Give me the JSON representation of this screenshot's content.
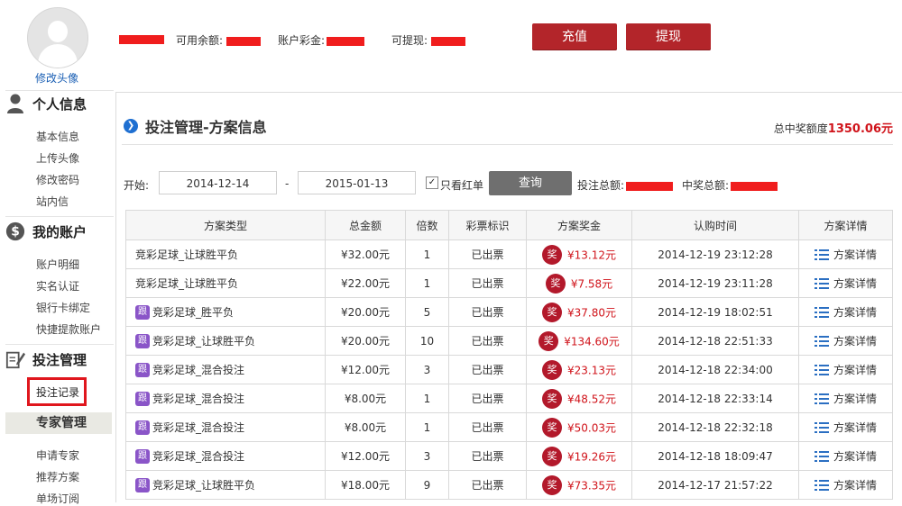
{
  "profile": {
    "change_avatar": "修改头像",
    "available_label": "可用余额:",
    "prize_label": "账户彩金:",
    "withdrawable_label": "可提现:"
  },
  "actions": {
    "recharge": "充值",
    "withdraw": "提现"
  },
  "sidebar": {
    "sections": [
      {
        "title": "个人信息",
        "icon": "user-icon",
        "items": [
          "基本信息",
          "上传头像",
          "修改密码",
          "站内信"
        ]
      },
      {
        "title": "我的账户",
        "icon": "dollar-icon",
        "items": [
          "账户明细",
          "实名认证",
          "银行卡绑定",
          "快捷提款账户"
        ]
      },
      {
        "title": "投注管理",
        "icon": "edit-icon",
        "items": [
          "投注记录"
        ]
      },
      {
        "title": "专家管理",
        "icon": "",
        "items": [
          "申请专家",
          "推荐方案",
          "单场订阅"
        ]
      }
    ],
    "active_item": "投注记录"
  },
  "main": {
    "title": "投注管理-方案信息",
    "total_prize_label": "总中奖额度",
    "total_prize_value": "1350.06元",
    "filter": {
      "start_label": "开始:",
      "start_date": "2014-12-14",
      "dash": "-",
      "end_date": "2015-01-13",
      "only_red_label": "只看红单",
      "only_red_checked": true,
      "query_button": "查询",
      "bet_total_label": "投注总额:",
      "win_total_label": "中奖总额:"
    },
    "table": {
      "headers": [
        "方案类型",
        "总金额",
        "倍数",
        "彩票标识",
        "方案奖金",
        "认购时间",
        "方案详情"
      ],
      "prize_badge": "奖",
      "follow_badge": "跟",
      "detail_label": "方案详情",
      "rows": [
        {
          "follow": false,
          "type": "竞彩足球_让球胜平负",
          "amount": "¥32.00元",
          "multiple": "1",
          "status": "已出票",
          "prize": "¥13.12元",
          "time": "2014-12-19 23:12:28"
        },
        {
          "follow": false,
          "type": "竞彩足球_让球胜平负",
          "amount": "¥22.00元",
          "multiple": "1",
          "status": "已出票",
          "prize": "¥7.58元",
          "time": "2014-12-19 23:11:28"
        },
        {
          "follow": true,
          "type": "竞彩足球_胜平负",
          "amount": "¥20.00元",
          "multiple": "5",
          "status": "已出票",
          "prize": "¥37.80元",
          "time": "2014-12-19 18:02:51"
        },
        {
          "follow": true,
          "type": "竞彩足球_让球胜平负",
          "amount": "¥20.00元",
          "multiple": "10",
          "status": "已出票",
          "prize": "¥134.60元",
          "time": "2014-12-18 22:51:33"
        },
        {
          "follow": true,
          "type": "竞彩足球_混合投注",
          "amount": "¥12.00元",
          "multiple": "3",
          "status": "已出票",
          "prize": "¥23.13元",
          "time": "2014-12-18 22:34:00"
        },
        {
          "follow": true,
          "type": "竞彩足球_混合投注",
          "amount": "¥8.00元",
          "multiple": "1",
          "status": "已出票",
          "prize": "¥48.52元",
          "time": "2014-12-18 22:33:14"
        },
        {
          "follow": true,
          "type": "竞彩足球_混合投注",
          "amount": "¥8.00元",
          "multiple": "1",
          "status": "已出票",
          "prize": "¥50.03元",
          "time": "2014-12-18 22:32:18"
        },
        {
          "follow": true,
          "type": "竞彩足球_混合投注",
          "amount": "¥12.00元",
          "multiple": "3",
          "status": "已出票",
          "prize": "¥19.26元",
          "time": "2014-12-18 18:09:47"
        },
        {
          "follow": true,
          "type": "竞彩足球_让球胜平负",
          "amount": "¥18.00元",
          "multiple": "9",
          "status": "已出票",
          "prize": "¥73.35元",
          "time": "2014-12-17 21:57:22"
        }
      ]
    }
  },
  "colors": {
    "brand_red": "#b3252a",
    "prize_red": "#d0131a",
    "follow_purple": "#8a55c8",
    "redaction": "#f01d1d"
  }
}
